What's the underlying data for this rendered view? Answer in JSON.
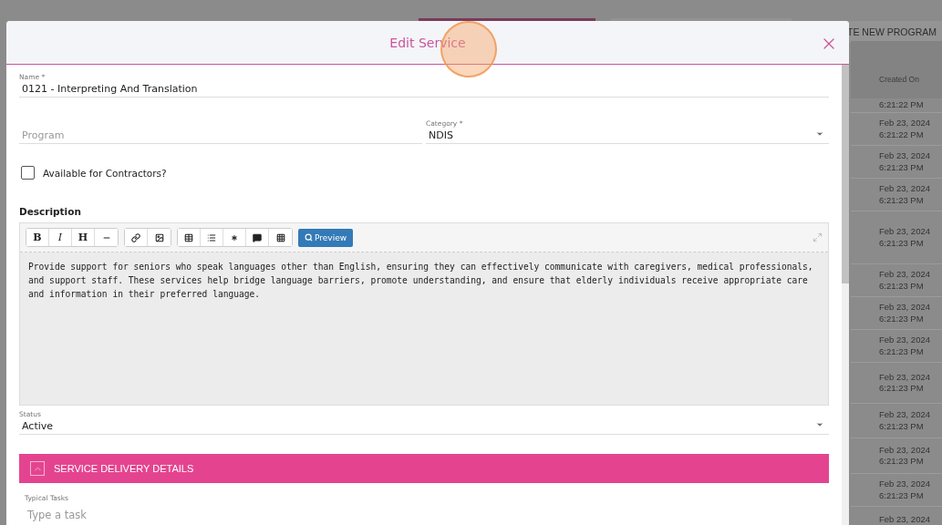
{
  "background": {
    "create_button": "TE NEW PROGRAM",
    "table": {
      "columns": [
        "Created On"
      ],
      "rows": [
        {
          "time": "6:21:22 PM"
        },
        {
          "date": "Feb 23, 2024",
          "time": "6:21:22 PM"
        },
        {
          "date": "Feb 23, 2024",
          "time": "6:21:23 PM"
        },
        {
          "date": "Feb 23, 2024",
          "time": "6:21:23 PM"
        },
        {
          "date": "Feb 23, 2024",
          "time": "6:21:23 PM"
        },
        {
          "date": "Feb 23, 2024",
          "time": "6:21:23 PM"
        },
        {
          "date": "Feb 23, 2024",
          "time": "6:21:23 PM"
        },
        {
          "date": "Feb 23, 2024",
          "time": "6:21:23 PM"
        },
        {
          "date": "Feb 23, 2024",
          "time": "6:21:23 PM"
        },
        {
          "date": "Feb 23, 2024",
          "time": "6:21:23 PM"
        },
        {
          "date": "Feb 23, 2024",
          "time": "6:21:23 PM"
        },
        {
          "date": "Feb 23, 2024",
          "time": "6:21:23 PM"
        },
        {
          "date": "Feb 23, 2024"
        }
      ]
    }
  },
  "dialog": {
    "title": "Edit Service",
    "name": {
      "label": "Name *",
      "value": "0121 - Interpreting And Translation"
    },
    "program": {
      "placeholder": "Program"
    },
    "category": {
      "label": "Category *",
      "value": "NDIS"
    },
    "contractors": {
      "label": "Available for Contractors?",
      "checked": false
    },
    "description": {
      "label": "Description",
      "toolbar": [
        [
          {
            "kind": "bold",
            "label": "B"
          },
          {
            "kind": "italic",
            "label": "I"
          },
          {
            "kind": "heading",
            "label": "H"
          },
          {
            "kind": "rule"
          }
        ],
        [
          {
            "kind": "link"
          },
          {
            "kind": "image"
          }
        ],
        [
          {
            "kind": "table"
          },
          {
            "kind": "list"
          },
          {
            "kind": "asterisk"
          },
          {
            "kind": "comment"
          },
          {
            "kind": "grid"
          }
        ]
      ],
      "preview": "Preview",
      "value": "Provide support for seniors who speak languages other than English, ensuring they can effectively communicate with caregivers, medical professionals, and support staff. These services help bridge language barriers, promote understanding, and ensure that elderly individuals receive appropriate care and information in their preferred language."
    },
    "status": {
      "label": "Status",
      "value": "Active"
    },
    "section": {
      "title": "SERVICE DELIVERY DETAILS",
      "expanded": true
    },
    "typical_tasks": {
      "label": "Typical Tasks",
      "placeholder": "Type a task"
    }
  }
}
